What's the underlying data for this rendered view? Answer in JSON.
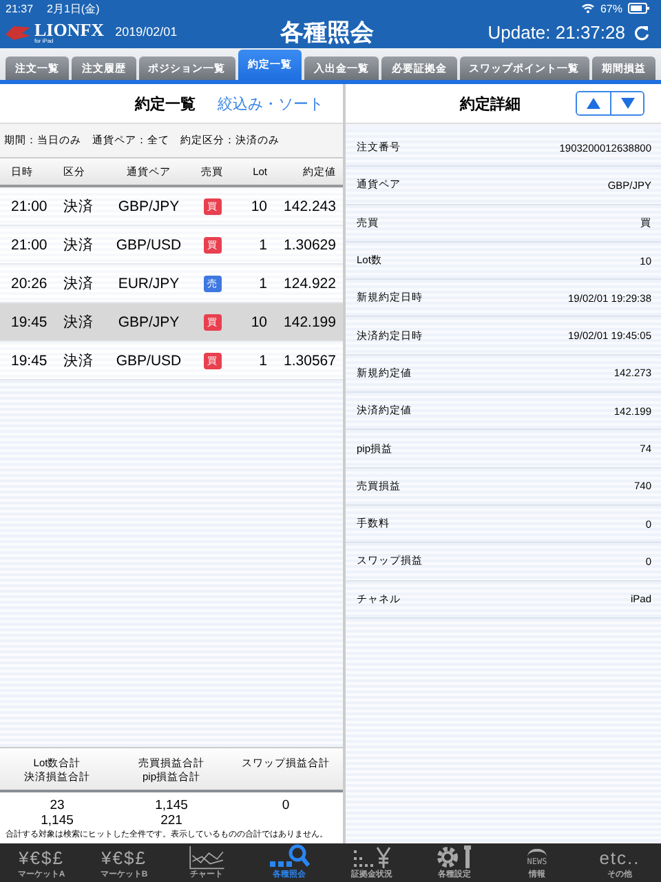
{
  "status_bar": {
    "time": "21:37",
    "date": "2月1日(金)",
    "battery": "67%"
  },
  "header": {
    "logo": "LIONFX",
    "logo_sub": "for iPad",
    "date": "2019/02/01",
    "title": "各種照会",
    "update": "Update: 21:37:28"
  },
  "tabs": [
    {
      "label": "注文一覧",
      "selected": false
    },
    {
      "label": "注文履歴",
      "selected": false
    },
    {
      "label": "ポジション一覧",
      "selected": false
    },
    {
      "label": "約定一覧",
      "selected": true
    },
    {
      "label": "入出金一覧",
      "selected": false
    },
    {
      "label": "必要証拠金",
      "selected": false
    },
    {
      "label": "スワップポイント一覧",
      "selected": false
    },
    {
      "label": "期間損益",
      "selected": false
    }
  ],
  "list_panel": {
    "title": "約定一覧",
    "filter_link": "絞込み・ソート",
    "conditions": "期間：当日のみ　通貨ペア：全て　約定区分：決済のみ",
    "columns": [
      "日時",
      "区分",
      "通貨ペア",
      "売買",
      "Lot",
      "約定値"
    ],
    "rows": [
      {
        "time": "21:00",
        "type": "決済",
        "pair": "GBP/JPY",
        "side": "買",
        "color": "#e8404f",
        "lot": "10",
        "price": "142.243",
        "selected": false
      },
      {
        "time": "21:00",
        "type": "決済",
        "pair": "GBP/USD",
        "side": "買",
        "color": "#e8404f",
        "lot": "1",
        "price": "1.30629",
        "selected": false
      },
      {
        "time": "20:26",
        "type": "決済",
        "pair": "EUR/JPY",
        "side": "売",
        "color": "#3f78e0",
        "lot": "1",
        "price": "124.922",
        "selected": false
      },
      {
        "time": "19:45",
        "type": "決済",
        "pair": "GBP/JPY",
        "side": "買",
        "color": "#e8404f",
        "lot": "10",
        "price": "142.199",
        "selected": true
      },
      {
        "time": "19:45",
        "type": "決済",
        "pair": "GBP/USD",
        "side": "買",
        "color": "#e8404f",
        "lot": "1",
        "price": "1.30567",
        "selected": false
      }
    ],
    "summary_labels": [
      [
        "Lot数合計",
        "売買損益合計",
        "スワップ損益合計"
      ],
      [
        "決済損益合計",
        "pip損益合計"
      ]
    ],
    "summary_values": [
      [
        "23",
        "1,145",
        "0"
      ],
      [
        "1,145",
        "221"
      ]
    ],
    "note": "合計する対象は検索にヒットした全件です。表示しているものの合計ではありません。"
  },
  "detail_panel": {
    "title": "約定詳細",
    "fields": [
      {
        "label": "注文番号",
        "value": "1903200012638800"
      },
      {
        "label": "通貨ペア",
        "value": "GBP/JPY"
      },
      {
        "label": "売買",
        "value": "買"
      },
      {
        "label": "Lot数",
        "value": "10"
      },
      {
        "label": "新規約定日時",
        "value": "19/02/01 19:29:38"
      },
      {
        "label": "決済約定日時",
        "value": "19/02/01 19:45:05"
      },
      {
        "label": "新規約定値",
        "value": "142.273"
      },
      {
        "label": "決済約定値",
        "value": "142.199"
      },
      {
        "label": "pip損益",
        "value": "74"
      },
      {
        "label": "売買損益",
        "value": "740"
      },
      {
        "label": "手数料",
        "value": "0"
      },
      {
        "label": "スワップ損益",
        "value": "0"
      },
      {
        "label": "チャネル",
        "value": "iPad"
      }
    ]
  },
  "tab_bar": [
    {
      "kind": "text",
      "icon_text": "¥€$£",
      "label": "マーケットA",
      "selected": false
    },
    {
      "kind": "text",
      "icon_text": "¥€$£",
      "label": "マーケットB",
      "selected": false
    },
    {
      "kind": "chart",
      "label": "チャート",
      "selected": false
    },
    {
      "kind": "search",
      "label": "各種照会",
      "selected": true
    },
    {
      "kind": "yen",
      "label": "証拠金状況",
      "selected": false
    },
    {
      "kind": "gear",
      "label": "各種設定",
      "selected": false
    },
    {
      "kind": "news",
      "icon_text": "NEWS",
      "label": "情報",
      "selected": false
    },
    {
      "kind": "text",
      "icon_text": "etc..",
      "label": "その他",
      "selected": false
    }
  ]
}
